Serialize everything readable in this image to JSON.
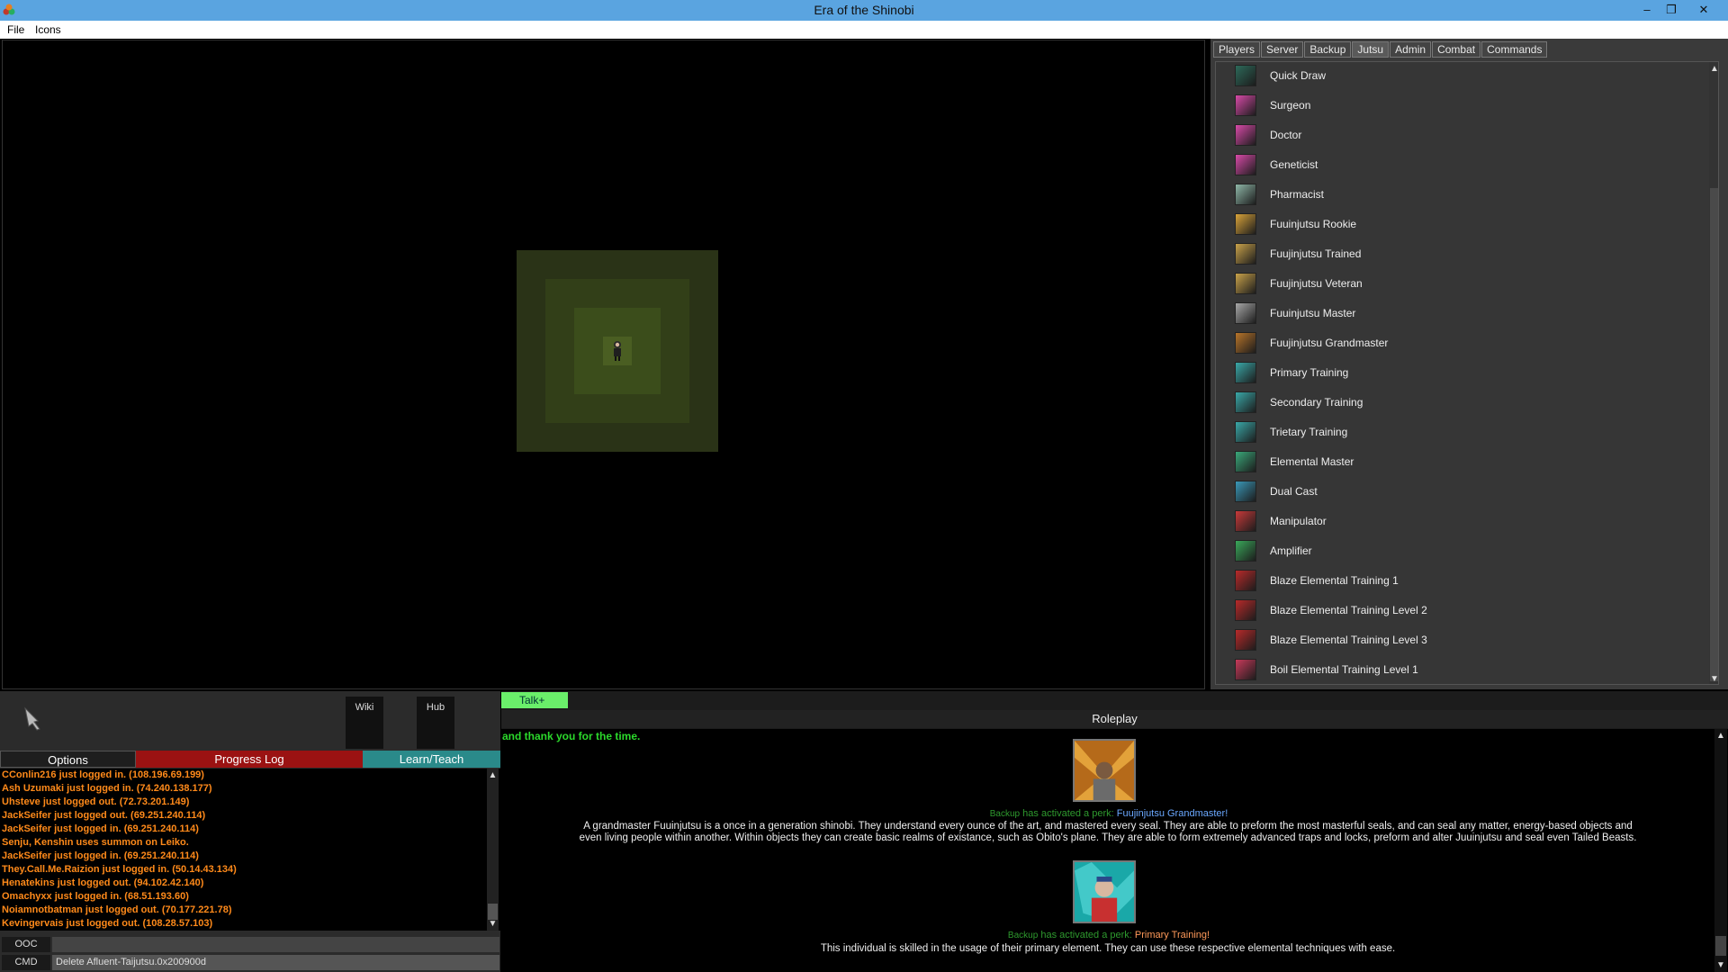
{
  "window": {
    "title": "Era of the Shinobi",
    "min": "–",
    "restore": "❐",
    "close": "✕"
  },
  "menu": [
    "File",
    "Icons"
  ],
  "tabs": [
    "Players",
    "Server",
    "Backup",
    "Jutsu",
    "Admin",
    "Combat",
    "Commands"
  ],
  "active_tab": "Jutsu",
  "jutsu": [
    {
      "label": "Quick Draw",
      "color": "#2d6a5a"
    },
    {
      "label": "Surgeon",
      "color": "#d84aa8"
    },
    {
      "label": "Doctor",
      "color": "#d84aa8"
    },
    {
      "label": "Geneticist",
      "color": "#d84aa8"
    },
    {
      "label": "Pharmacist",
      "color": "#8fb7a8"
    },
    {
      "label": "Fuuinjutsu Rookie",
      "color": "#d9a33a"
    },
    {
      "label": "Fuujinjutsu Trained",
      "color": "#c9a24a"
    },
    {
      "label": "Fuujinjutsu Veteran",
      "color": "#c9a24a"
    },
    {
      "label": "Fuuinjutsu Master",
      "color": "#a8a8a8"
    },
    {
      "label": "Fuujinjutsu Grandmaster",
      "color": "#b8752a"
    },
    {
      "label": "Primary Training",
      "color": "#3aa8a8"
    },
    {
      "label": "Secondary Training",
      "color": "#3aa8a8"
    },
    {
      "label": "Trietary Training",
      "color": "#3aa8a8"
    },
    {
      "label": "Elemental Master",
      "color": "#3aa87a"
    },
    {
      "label": "Dual Cast",
      "color": "#3a98b8"
    },
    {
      "label": "Manipulator",
      "color": "#c83a3a"
    },
    {
      "label": "Amplifier",
      "color": "#3aa85a"
    },
    {
      "label": "Blaze Elemental Training 1",
      "color": "#b82a2a"
    },
    {
      "label": "Blaze Elemental Training Level 2",
      "color": "#b82a2a"
    },
    {
      "label": "Blaze Elemental Training Level 3",
      "color": "#b82a2a"
    },
    {
      "label": "Boil Elemental Training Level 1",
      "color": "#c83a5a"
    }
  ],
  "tool": {
    "wiki": "Wiki",
    "hub": "Hub"
  },
  "lower_tabs": {
    "options": "Options",
    "progress": "Progress Log",
    "learn": "Learn/Teach"
  },
  "log": [
    "CConlin216 just logged in. (108.196.69.199)",
    "Ash Uzumaki just logged in. (74.240.138.177)",
    "Uhsteve just logged out. (72.73.201.149)",
    "JackSeifer just logged out. (69.251.240.114)",
    "JackSeifer just logged in. (69.251.240.114)",
    "Senju, Kenshin uses summon on Leiko.",
    "JackSeifer just logged in. (69.251.240.114)",
    "They.Call.Me.Raizion just logged in. (50.14.43.134)",
    "Henatekins just logged out. (94.102.42.140)",
    "Omachyxx just logged in. (68.51.193.60)",
    "Noiamnotbatman just logged out. (70.177.221.78)",
    "Kevingervais just logged out. (108.28.57.103)"
  ],
  "ooc": {
    "label": "OOC",
    "value": ""
  },
  "cmd": {
    "label": "CMD",
    "value": "Delete Afluent-Taijutsu.0x200900d"
  },
  "chat": {
    "talk_button": "Talk+",
    "header": "Roleplay",
    "top_line": "and thank you for the time.",
    "perks": [
      {
        "who": "Backup",
        "activated": "has activated a perk:",
        "name": "Fuujinjutsu Grandmaster!",
        "name_color": "#6aa8ff",
        "desc1": "A grandmaster Fuuinjutsu is a once in a generation shinobi.  They understand every ounce of the art, and mastered every seal.  They are able to preform the most masterful seals, and can seal any matter, energy-based objects and",
        "desc2": "even living people within another.  Within objects they can create basic realms of existance, such as Obito's plane.  They are able to form extremely advanced traps and locks, preform and alter Juuinjutsu and seal even Tailed Beasts."
      },
      {
        "who": "Backup",
        "activated": "has activated a perk:",
        "name": "Primary Training!",
        "name_color": "#ff9a5a",
        "desc1": "This individual is skilled in the usage of their primary element.  They can use these respective elemental techniques with ease.",
        "desc2": ""
      }
    ]
  }
}
